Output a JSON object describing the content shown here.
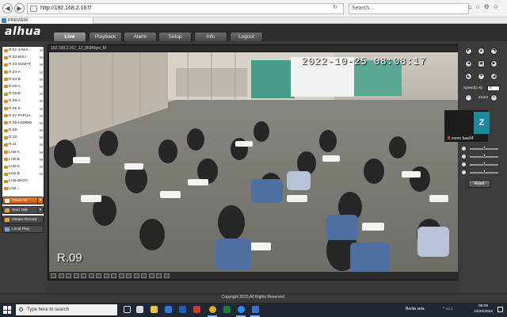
{
  "browser": {
    "url": "http://192.168.2.167/",
    "search_placeholder": "Search...",
    "tab_title": "PREVIEW"
  },
  "app": {
    "logo": "alhua",
    "tabs": [
      "Live",
      "Playback",
      "Alarm",
      "Setup",
      "Info",
      "Logout"
    ],
    "active_tab": "Live"
  },
  "channels": [
    {
      "name": "R.01-JAWA",
      "mark": "M"
    },
    {
      "name": "R.02-BALI",
      "mark": "M"
    },
    {
      "name": "R.03-SUMAT",
      "mark": "M"
    },
    {
      "name": "R.04-A",
      "mark": "M"
    },
    {
      "name": "R.04-B",
      "mark": "M"
    },
    {
      "name": "R.05-A",
      "mark": "M"
    },
    {
      "name": "R.05-B",
      "mark": "M"
    },
    {
      "name": "R.06-A",
      "mark": "M"
    },
    {
      "name": "R.06 B",
      "mark": "M"
    },
    {
      "name": "R.07-PAPUA",
      "mark": "M"
    },
    {
      "name": "R.08-LOMBO",
      "mark": "M"
    },
    {
      "name": "R.09",
      "mark": "M"
    },
    {
      "name": "R.10",
      "mark": "M"
    },
    {
      "name": "R.11",
      "mark": "M"
    },
    {
      "name": "LAB-A",
      "mark": "M"
    },
    {
      "name": "LAB-B",
      "mark": "M"
    },
    {
      "name": "LAB-C",
      "mark": "M"
    },
    {
      "name": "LAB-D",
      "mark": "M"
    },
    {
      "name": "LAB-JRGN",
      "mark": ""
    },
    {
      "name": "LAB-...",
      "mark": ""
    }
  ],
  "left_buttons": {
    "close_all": "Close All",
    "start_talk": "Start Talk",
    "instant_record": "Instant Record",
    "local_play": "Local Play"
  },
  "video": {
    "stream_info": "192.168.2.167_12_959Kbps_M",
    "timestamp": "2022-10-25 08:08:17",
    "channel_label": "R.09"
  },
  "ptz": {
    "speed_label": "Speed(1-8)",
    "speed_value": "5",
    "zoom_label": "Zoom",
    "reset_label": "Reset"
  },
  "zoom_overlay": {
    "avatar_letter": "Z",
    "name": "zoom baa04"
  },
  "image_adjust": [
    {
      "name": "brightness",
      "level": 0.5
    },
    {
      "name": "contrast",
      "level": 0.5
    },
    {
      "name": "saturation",
      "level": 0.5
    },
    {
      "name": "hue",
      "level": 0.5
    }
  ],
  "footer": "Copyright 2015,All Rights Reserved.",
  "taskbar": {
    "search_placeholder": "Type here to search",
    "tray_text": "Berita sela",
    "time": "08:09",
    "date": "10/25/2022"
  }
}
